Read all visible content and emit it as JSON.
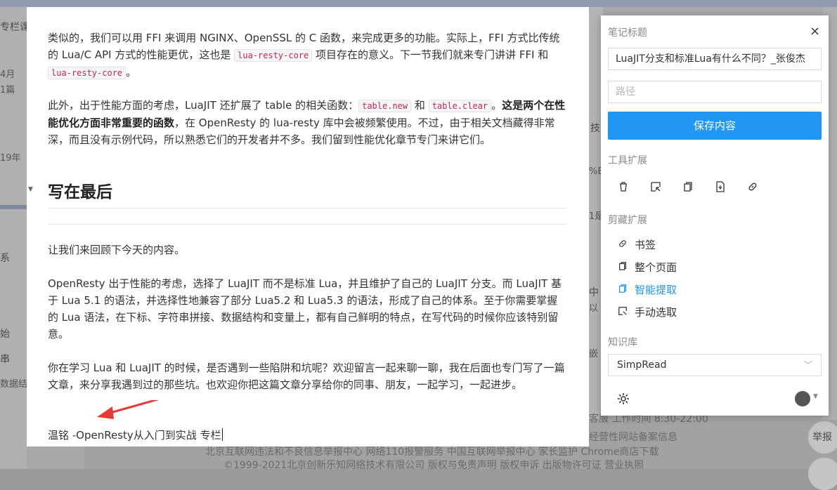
{
  "background": {
    "left_texts": [
      "专栏课",
      "4月",
      "1篇",
      "19年",
      "系",
      "始",
      "串",
      "数据结"
    ],
    "right_texts": [
      "技",
      "%E",
      "1是",
      "中",
      "以",
      "嵌"
    ],
    "footer_line1": "客服  工作时间 8:30-22:00",
    "footer_line2": "经营性网站备案信息",
    "footer_line3": "北京互联网违法和不良信息举报中心 网络110报警服务 中国互联网举报中心 家长监护 Chrome商店下载",
    "footer_line4": "©1999-2021北京创新乐知网络技术有限公司 版权与免责声明 版权申诉 出版物许可证 营业执照",
    "report_label": "举报"
  },
  "article": {
    "p1": {
      "t1": "类似的，我们可以用 FFI 来调用 NGINX、OpenSSL 的 C 函数，来完成更多的功能。实际上，FFI 方式比传统的 Lua/C API 方式的性能更优，这也是 ",
      "code1": "lua-resty-core",
      "t2": " 项目存在的意义。下一节我们就来专门讲讲 FFI 和 ",
      "code2": "lua-resty-core",
      "t3": "。"
    },
    "p2": {
      "t1": "此外，出于性能方面的考虑，LuaJIT 还扩展了 table 的相关函数：",
      "code1": "table.new",
      "t2": " 和 ",
      "code2": "table.clear",
      "t3": "。",
      "bold": "这是两个在性能优化方面非常重要的函数",
      "t4": "，在 OpenResty 的 lua-resty 库中会被频繁使用。不过，由于相关文档藏得非常深，而且没有示例代码，所以熟悉它们的开发者并不多。我们留到性能优化章节专门来讲它们。"
    },
    "heading": "写在最后",
    "p3": "让我们来回顾下今天的内容。",
    "p4": "OpenResty 出于性能的考虑，选择了 LuaJIT 而不是标准 Lua，并且维护了自己的 LuaJIT 分支。而 LuaJIT 基于 Lua 5.1 的语法，并选择性地兼容了部分 Lua5.2 和 Lua5.3 的语法，形成了自己的体系。至于你需要掌握的 Lua 语法，在下标、字符串拼接、数据结构和变量上，都有自己鲜明的特点，在写代码的时候你应该特别留意。",
    "p5": "你在学习 Lua 和 LuaJIT 的时候，是否遇到一些陷阱和坑呢？欢迎留言一起来聊一聊，我在后面也专门写了一篇文章，来分享我遇到过的那些坑。也欢迎你把这篇文章分享给你的同事、朋友，一起学习，一起进步。",
    "p6": "温铭 -OpenResty从入门到实战 专栏"
  },
  "panel": {
    "title_label": "笔记标题",
    "title_value": "LuaJIT分支和标准Lua有什么不同？_张俊杰",
    "path_placeholder": "路径",
    "save_label": "保存内容",
    "tools_label": "工具扩展",
    "clip_label": "剪藏扩展",
    "clip_items": [
      "书签",
      "整个页面",
      "智能提取",
      "手动选取"
    ],
    "kb_label": "知识库",
    "kb_value": "SimpRead",
    "accent": "#2196f3"
  }
}
